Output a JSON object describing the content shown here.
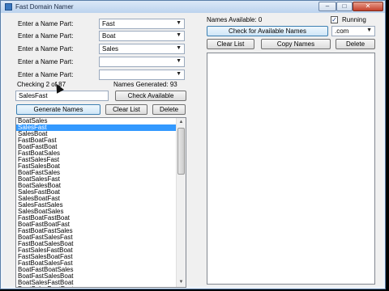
{
  "window": {
    "title": "Fast Domain Namer",
    "min_symbol": "–",
    "max_symbol": "□",
    "close_symbol": "✕"
  },
  "parts": {
    "label": "Enter a Name Part:",
    "values": [
      "Fast",
      "Boat",
      "Sales",
      "",
      ""
    ]
  },
  "status": {
    "checking": "Checking 2 of 87",
    "generated": "Names Generated: 93"
  },
  "input": {
    "value": "SalesFast"
  },
  "buttons": {
    "check_available": "Check Available",
    "generate_names": "Generate Names",
    "clear_list": "Clear List",
    "delete": "Delete"
  },
  "names_list": {
    "selected_index": 1,
    "items": [
      "BoatSales",
      "SalesFast",
      "SalesBoat",
      "FastBoatFast",
      "BoatFastBoat",
      "FastBoatSales",
      "FastSalesFast",
      "FastSalesBoat",
      "BoatFastSales",
      "BoatSalesFast",
      "BoatSalesBoat",
      "SalesFastBoat",
      "SalesBoatFast",
      "SalesFastSales",
      "SalesBoatSales",
      "FastBoatFastBoat",
      "BoatFastBoatFast",
      "FastBoatFastSales",
      "BoatFastSalesFast",
      "FastBoatSalesBoat",
      "FastSalesFastBoat",
      "FastSalesBoatFast",
      "FastBoatSalesFast",
      "BoatFastBoatSales",
      "BoatFastSalesBoat",
      "BoatSalesFastBoat",
      "BoatSalesBoatFast"
    ]
  },
  "right_panel": {
    "names_available": "Names Available: 0",
    "running_label": "Running",
    "running_checked": "✓",
    "check_for_available": "Check for Available Names",
    "tld": ".com",
    "clear_list": "Clear List",
    "copy_names": "Copy Names",
    "delete": "Delete"
  }
}
